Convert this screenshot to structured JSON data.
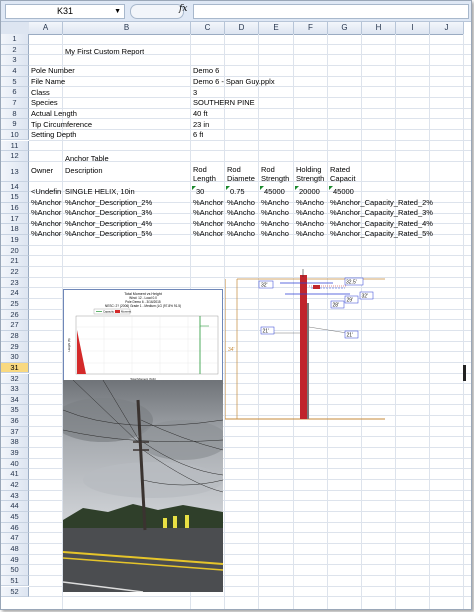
{
  "formula_bar": {
    "name_box": "K31",
    "fx": "fx",
    "value": ""
  },
  "columns": [
    "A",
    "B",
    "C",
    "D",
    "E",
    "F",
    "G",
    "H",
    "I",
    "J"
  ],
  "rows": [
    "1",
    "2",
    "3",
    "4",
    "5",
    "6",
    "7",
    "8",
    "9",
    "10",
    "11",
    "12",
    "13",
    "14",
    "15",
    "16",
    "17",
    "18",
    "19",
    "20",
    "21",
    "22",
    "23",
    "24",
    "25",
    "26",
    "27",
    "28",
    "29",
    "30",
    "31",
    "32",
    "33",
    "34",
    "35",
    "36",
    "37",
    "38",
    "39",
    "40",
    "41",
    "42",
    "43",
    "44",
    "45",
    "46",
    "47",
    "48",
    "49",
    "50",
    "51",
    "52"
  ],
  "selected_row": "31",
  "report": {
    "title": "My First Custom Report",
    "fields": [
      {
        "label": "Pole Number",
        "value": "Demo 6"
      },
      {
        "label": "File Name",
        "value": "Demo 6 - Span Guy.pplx"
      },
      {
        "label": "Class",
        "value": "3"
      },
      {
        "label": "Species",
        "value": "SOUTHERN PINE"
      },
      {
        "label": "Actual Length",
        "value": "40 ft"
      },
      {
        "label": "Tip Circumference",
        "value": "23 in"
      },
      {
        "label": "Setting Depth",
        "value": "6 ft"
      }
    ],
    "anchor_table": {
      "title": "Anchor Table",
      "headers": [
        "Owner",
        "Description",
        "Rod Length",
        "Rod Diamete",
        "Rod Strength",
        "Holding Strength",
        "Rated Capacit"
      ],
      "row14": [
        "<Undefin",
        "SINGLE HELIX, 10in",
        "30",
        "0.75",
        "45000",
        "20000",
        "45000"
      ],
      "template_rows": [
        {
          "a": "%Anchor",
          "b": "%Anchor_Description_2%",
          "c": "%Anchor",
          "d": "%Ancho",
          "e": "%Ancho",
          "f": "%Ancho",
          "g": "%Anchor_Capacity_Rated_2%"
        },
        {
          "a": "%Anchor",
          "b": "%Anchor_Description_3%",
          "c": "%Anchor",
          "d": "%Ancho",
          "e": "%Ancho",
          "f": "%Ancho",
          "g": "%Anchor_Capacity_Rated_3%"
        },
        {
          "a": "%Anchor",
          "b": "%Anchor_Description_4%",
          "c": "%Anchor",
          "d": "%Ancho",
          "e": "%Ancho",
          "f": "%Ancho",
          "g": "%Anchor_Capacity_Rated_4%"
        },
        {
          "a": "%Anchor",
          "b": "%Anchor_Description_5%",
          "c": "%Anchor",
          "d": "%Ancho",
          "e": "%Ancho",
          "f": "%Ancho",
          "g": "%Anchor_Capacity_Rated_5%"
        }
      ]
    }
  },
  "embedded_chart": {
    "title_lines": [
      "Total Moment vs Height",
      "Wind: 12 - Load 0.0",
      "Pole Demo 6 - 3/16/2015",
      "NESC: 2? (2006) Grade 1 - Medium (LG (97.8% 91.5)"
    ],
    "legend": [
      "Capacity ---",
      "Moment"
    ],
    "xlabel": "Total Moment (ft-lb)",
    "ylabel": "Height (ft)"
  },
  "pole_diagram": {
    "labels": [
      "32'",
      "32.5'",
      "32'",
      "29'",
      "28'",
      "21'",
      "21'",
      "34'"
    ]
  }
}
